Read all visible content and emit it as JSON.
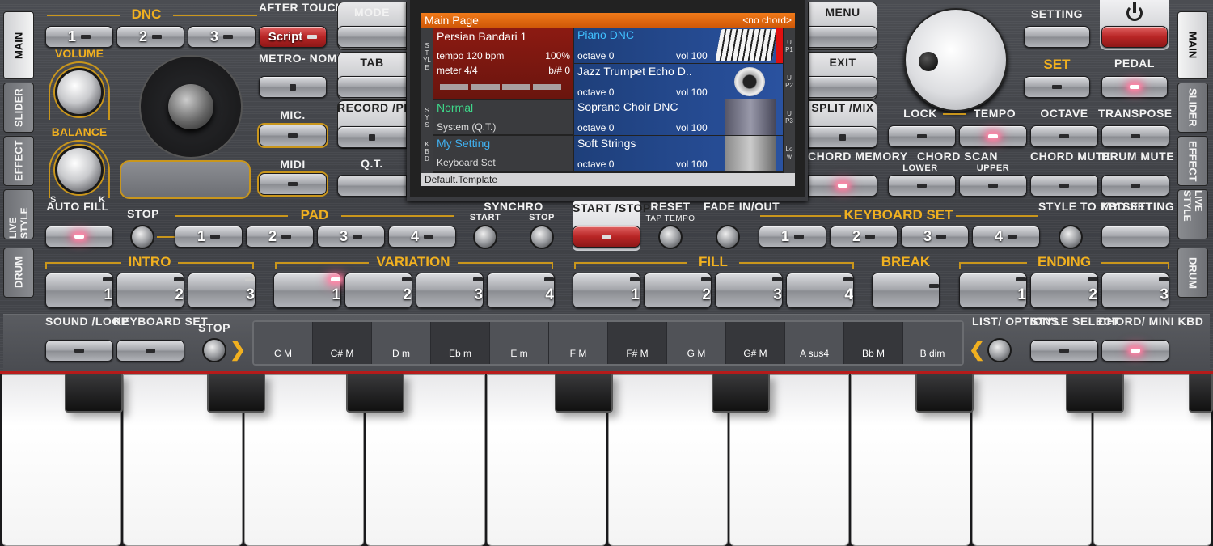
{
  "tabs": {
    "main": "MAIN",
    "slider": "SLIDER",
    "effect": "EFFECT",
    "live_style": "LIVE STYLE",
    "drum": "DRUM"
  },
  "left": {
    "dnc": "DNC",
    "dnc_buttons": [
      "1",
      "2",
      "3"
    ],
    "after_touch": "AFTER TOUCH",
    "script": "Script",
    "volume": "VOLUME",
    "balance": "BALANCE",
    "balance_s": "S",
    "balance_k": "K",
    "metronome": "METRO- NOME",
    "mic": "MIC.",
    "midi": "MIDI"
  },
  "mid_buttons": {
    "mode": "MODE",
    "tab": "TAB",
    "record": "RECORD /PLAY",
    "qt": "Q.T.",
    "menu": "MENU",
    "exit": "EXIT",
    "split": "SPLIT /MIX",
    "chord_memory": "CHORD MEMORY"
  },
  "screen": {
    "title": "Main Page",
    "chord": "<no chord>",
    "side_style": "STYLE",
    "side_sys": "SYS",
    "side_kbd": "KBD",
    "style_name": "Persian Bandari 1",
    "tempo": "tempo 120 bpm",
    "percent": "100%",
    "meter": "meter 4/4",
    "bsharp": "b/# 0",
    "sys_name": "Normal",
    "sys_sub": "System (Q.T.)",
    "kbd_name": "My Setting",
    "kbd_sub": "Keyboard Set",
    "footer": "Default.Template",
    "voices": [
      {
        "name": "Piano DNC",
        "octave": "octave 0",
        "vol": "vol 100",
        "tag": "UP1"
      },
      {
        "name": "Jazz Trumpet Echo D..",
        "octave": "octave 0",
        "vol": "vol 100",
        "tag": "UP2"
      },
      {
        "name": "Soprano Choir DNC",
        "octave": "octave 0",
        "vol": "vol 100",
        "tag": "UP3"
      },
      {
        "name": "Soft Strings",
        "octave": "octave 0",
        "vol": "vol 100",
        "tag": "Low"
      }
    ]
  },
  "right": {
    "setting": "SETTING",
    "set": "SET",
    "pedal": "PEDAL",
    "lock": "LOCK",
    "tempo": "TEMPO",
    "octave": "OCTAVE",
    "transpose": "TRANSPOSE",
    "chord_scan": "CHORD SCAN",
    "lower": "LOWER",
    "upper": "UPPER",
    "chord_mute": "CHORD MUTE",
    "drum_mute": "DRUM MUTE"
  },
  "row3": {
    "auto_fill": "AUTO FILL",
    "stop": "STOP",
    "pad": "PAD",
    "pad_buttons": [
      "1",
      "2",
      "3",
      "4"
    ],
    "synchro": "SYNCHRO",
    "sync_start": "START",
    "sync_stop": "STOP",
    "start_stop": "START /STOP",
    "reset": "RESET",
    "tap_tempo": "TAP TEMPO",
    "fade": "FADE IN/OUT",
    "keyboard_set": "KEYBOARD SET",
    "kbd_buttons": [
      "1",
      "2",
      "3",
      "4"
    ],
    "style_to_kbd": "STYLE TO KBD SET",
    "my_setting": "MY SETTING"
  },
  "row4": {
    "intro": "INTRO",
    "variation": "VARIATION",
    "fill": "FILL",
    "break": "BREAK",
    "ending": "ENDING",
    "nums3": [
      "1",
      "2",
      "3"
    ],
    "nums4": [
      "1",
      "2",
      "3",
      "4"
    ]
  },
  "row5": {
    "sound_loop": "SOUND /LOOP",
    "keyboard_set": "KEYBOARD SET",
    "stop": "STOP",
    "list_options": "LIST/ OPTIONS",
    "style_select": "STYLE SELECT",
    "chord_mini": "CHORD/ MINI KBD",
    "chords": [
      "C M",
      "C# M",
      "D m",
      "Eb m",
      "E m",
      "F M",
      "F# M",
      "G M",
      "G# M",
      "A sus4",
      "Bb M",
      "B dim"
    ]
  }
}
